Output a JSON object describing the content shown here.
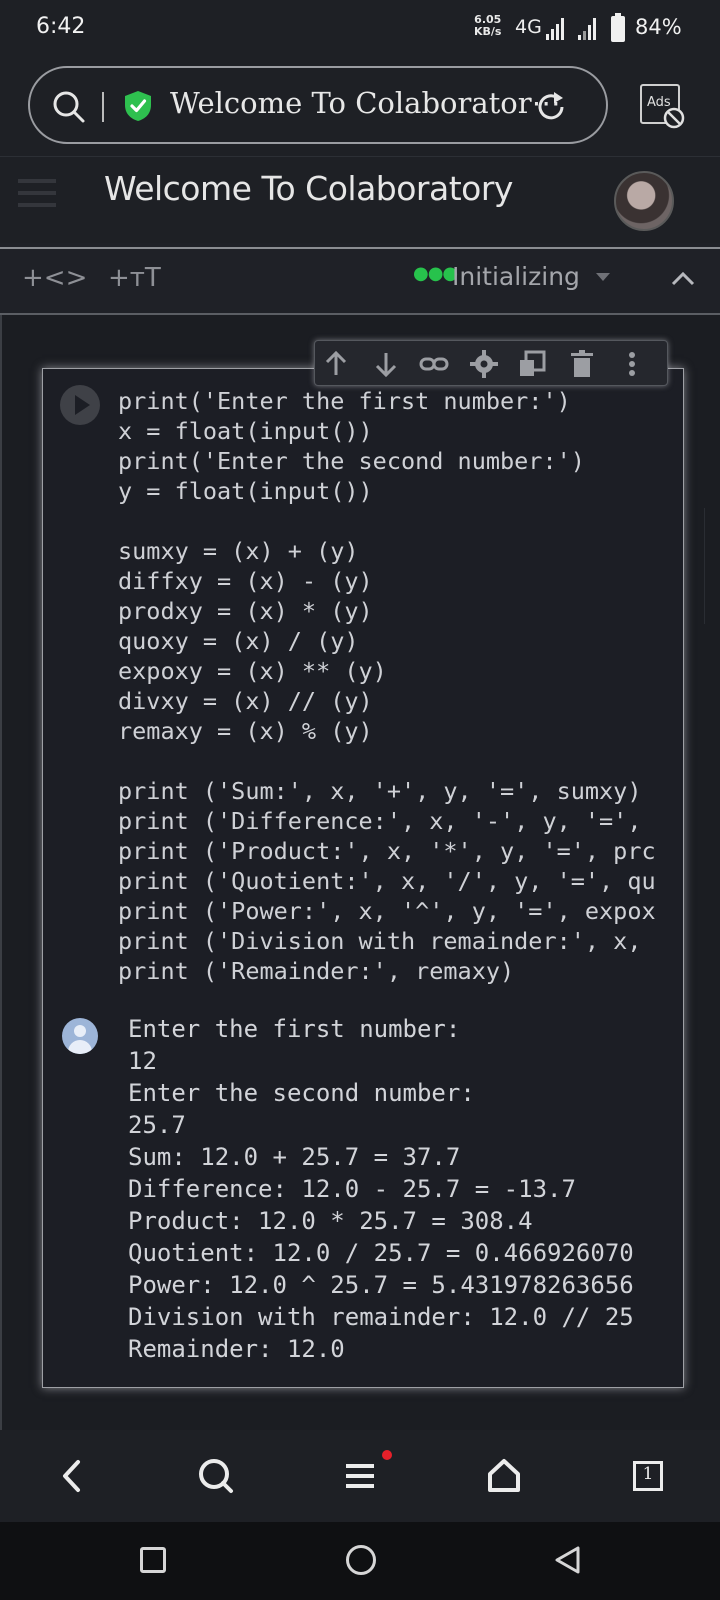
{
  "status_bar": {
    "time": "6:42",
    "net_speed_value": "6.05",
    "net_speed_unit": "KB/s",
    "network_type": "4G",
    "battery": "84%"
  },
  "browser": {
    "url_title": "Welcome To Colaborator⋯",
    "ads_label": "Ads"
  },
  "colab": {
    "page_title": "Welcome To Colaboratory",
    "toolbar": {
      "code_label": "+<>",
      "text_label": "+тT",
      "status": "Initializing"
    }
  },
  "cell": {
    "code": "print('Enter the first number:')\nx = float(input())\nprint('Enter the second number:')\ny = float(input())\n\nsumxy = (x) + (y)\ndiffxy = (x) - (y)\nprodxy = (x) * (y)\nquoxy = (x) / (y)\nexpoxy = (x) ** (y)\ndivxy = (x) // (y)\nremaxy = (x) % (y)\n\nprint ('Sum:', x, '+', y, '=', sumxy)\nprint ('Difference:', x, '-', y, '=',\nprint ('Product:', x, '*', y, '=', prc\nprint ('Quotient:', x, '/', y, '=', qu\nprint ('Power:', x, '^', y, '=', expox\nprint ('Division with remainder:', x,\nprint ('Remainder:', remaxy)",
    "output": "Enter the first number:\n12\nEnter the second number:\n25.7\nSum: 12.0 + 25.7 = 37.7\nDifference: 12.0 - 25.7 = -13.7\nProduct: 12.0 * 25.7 = 308.4\nQuotient: 12.0 / 25.7 = 0.466926070\nPower: 12.0 ^ 25.7 = 5.431978263656\nDivision with remainder: 12.0 // 25\nRemainder: 12.0"
  },
  "icons": {
    "cell_toolbar": [
      "arrow-up-icon",
      "arrow-down-icon",
      "link-icon",
      "gear-icon",
      "mirror-cell-icon",
      "trash-icon",
      "more-vert-icon"
    ],
    "browser_nav": [
      "back-icon",
      "search-icon",
      "menu-icon",
      "home-icon",
      "tabs-icon"
    ],
    "tabs_count": "1"
  },
  "colors": {
    "accent_green": "#27c24c",
    "shield_green": "#2ec04f",
    "notification_red": "#e8202a"
  }
}
